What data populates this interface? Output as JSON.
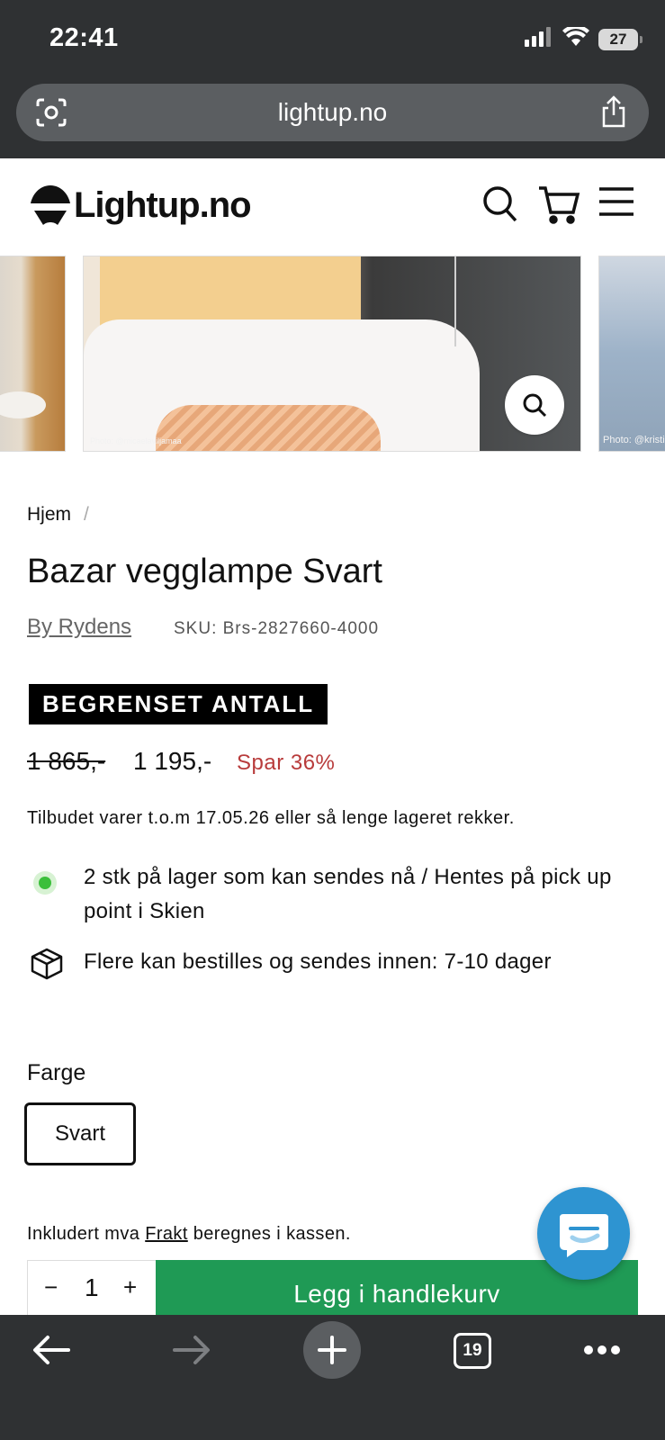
{
  "status_bar": {
    "time": "22:41",
    "battery": "27",
    "icons": [
      "signal-icon",
      "wifi-icon",
      "battery-icon"
    ]
  },
  "browser": {
    "url": "lightup.no",
    "tab_count": "19"
  },
  "site": {
    "logo_text": "Lightup.no",
    "header_icons": [
      "search-icon",
      "cart-icon",
      "menu-icon"
    ]
  },
  "gallery": {
    "credit_main": "Photo: @micaelaviljamaa",
    "credit_right": "Photo: @kristin"
  },
  "product": {
    "breadcrumb_home": "Hjem",
    "breadcrumb_sep": "/",
    "title": "Bazar vegglampe Svart",
    "brand": "By Rydens",
    "sku": "SKU: Brs-2827660-4000",
    "badge": "BEGRENSET ANTALL",
    "price_old": "1 865,-",
    "price_new": "1 195,-",
    "price_save": "Spar 36%",
    "offer_text": "Tilbudet varer t.o.m 17.05.26 eller så lenge lageret rekker.",
    "stock_now": "2 stk på lager som kan sendes nå / Hentes på pick up point i Skien",
    "stock_order": "Flere kan bestilles og sendes innen: 7-10 dager",
    "color_label": "Farge",
    "color_selected": "Svart",
    "vat_prefix": "Inkludert mva ",
    "vat_link": "Frakt",
    "vat_suffix": " beregnes i kassen.",
    "qty_minus": "−",
    "qty_value": "1",
    "qty_plus": "+",
    "add_to_cart": "Legg i handlekurv"
  },
  "colors": {
    "accent_green": "#1f9a55",
    "sale_red": "#b83b3b",
    "chat_blue": "#2e94d1",
    "chrome": "#2f3133"
  }
}
